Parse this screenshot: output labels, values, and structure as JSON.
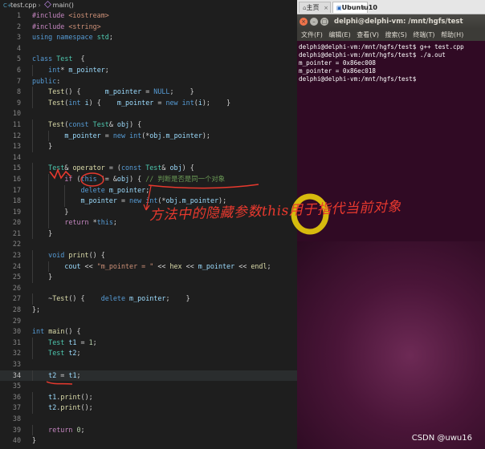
{
  "editor": {
    "breadcrumb": {
      "file": "test.cpp",
      "symbol": "main()"
    },
    "cursor_line": "34",
    "lines": [
      {
        "n": "1",
        "html": "<span class=\"pp\">#include</span> <span class=\"inc\">&lt;iostream&gt;</span>"
      },
      {
        "n": "2",
        "html": "<span class=\"pp\">#include</span> <span class=\"inc\">&lt;string&gt;</span>"
      },
      {
        "n": "3",
        "html": "<span class=\"kw\">using</span> <span class=\"kw\">namespace</span> <span class=\"ty\">std</span>;"
      },
      {
        "n": "4",
        "html": ""
      },
      {
        "n": "5",
        "html": "<span class=\"kw\">class</span> <span class=\"ty\">Test</span>  {"
      },
      {
        "n": "6",
        "html": "    <span class=\"kw\">int</span>* <span class=\"var\">m_pointer</span>;"
      },
      {
        "n": "7",
        "html": "<span class=\"kw\">public</span>:"
      },
      {
        "n": "8",
        "html": "    <span class=\"fn\">Test</span>() {      <span class=\"var\">m_pointer</span> = <span class=\"kw\">NULL</span>;    }"
      },
      {
        "n": "9",
        "html": "    <span class=\"fn\">Test</span>(<span class=\"kw\">int</span> <span class=\"var\">i</span>) {    <span class=\"var\">m_pointer</span> = <span class=\"kw\">new</span> <span class=\"kw\">int</span>(<span class=\"var\">i</span>);    }"
      },
      {
        "n": "10",
        "html": ""
      },
      {
        "n": "11",
        "html": "    <span class=\"fn\">Test</span>(<span class=\"kw\">const</span> <span class=\"ty\">Test</span>&amp; <span class=\"var\">obj</span>) {"
      },
      {
        "n": "12",
        "html": "        <span class=\"var\">m_pointer</span> = <span class=\"kw\">new</span> <span class=\"kw\">int</span>(*<span class=\"var\">obj</span>.<span class=\"var\">m_pointer</span>);"
      },
      {
        "n": "13",
        "html": "    }"
      },
      {
        "n": "14",
        "html": ""
      },
      {
        "n": "15",
        "html": "    <span class=\"ty\">Test</span>&amp; <span class=\"fn\">operator</span> = (<span class=\"kw\">const</span> <span class=\"ty\">Test</span>&amp; <span class=\"var\">obj</span>) {"
      },
      {
        "n": "16",
        "html": "        <span class=\"ctl\">if</span> (<span class=\"kw\">this</span> != &amp;<span class=\"var\">obj</span>) { <span class=\"com\">// 判断是否是同一个对象</span>"
      },
      {
        "n": "17",
        "html": "            <span class=\"kw\">delete</span> <span class=\"var\">m_pointer</span>;"
      },
      {
        "n": "18",
        "html": "            <span class=\"var\">m_pointer</span> = <span class=\"kw\">new</span> <span class=\"kw\">int</span>(*<span class=\"var\">obj</span>.<span class=\"var\">m_pointer</span>);"
      },
      {
        "n": "19",
        "html": "        }"
      },
      {
        "n": "20",
        "html": "        <span class=\"ctl\">return</span> *<span class=\"kw\">this</span>;"
      },
      {
        "n": "21",
        "html": "    }"
      },
      {
        "n": "22",
        "html": ""
      },
      {
        "n": "23",
        "html": "    <span class=\"kw\">void</span> <span class=\"fn\">print</span>() {"
      },
      {
        "n": "24",
        "html": "        <span class=\"var\">cout</span> &lt;&lt; <span class=\"str\">\"m_pointer = \"</span> &lt;&lt; <span class=\"fn\">hex</span> &lt;&lt; <span class=\"var\">m_pointer</span> &lt;&lt; <span class=\"fn\">endl</span>;"
      },
      {
        "n": "25",
        "html": "    }"
      },
      {
        "n": "26",
        "html": ""
      },
      {
        "n": "27",
        "html": "    ~<span class=\"fn\">Test</span>() {    <span class=\"kw\">delete</span> <span class=\"var\">m_pointer</span>;    }"
      },
      {
        "n": "28",
        "html": "};"
      },
      {
        "n": "29",
        "html": ""
      },
      {
        "n": "30",
        "html": "<span class=\"kw\">int</span> <span class=\"fn\">main</span>() {"
      },
      {
        "n": "31",
        "html": "    <span class=\"ty\">Test</span> <span class=\"var\">t1</span> = <span class=\"num\">1</span>;"
      },
      {
        "n": "32",
        "html": "    <span class=\"ty\">Test</span> <span class=\"var\">t2</span>;"
      },
      {
        "n": "33",
        "html": ""
      },
      {
        "n": "34",
        "html": "    <span class=\"var\">t2</span> = <span class=\"var\">t1</span>;"
      },
      {
        "n": "35",
        "html": ""
      },
      {
        "n": "36",
        "html": "    <span class=\"var\">t1</span>.<span class=\"fn\">print</span>();"
      },
      {
        "n": "37",
        "html": "    <span class=\"var\">t2</span>.<span class=\"fn\">print</span>();"
      },
      {
        "n": "38",
        "html": ""
      },
      {
        "n": "39",
        "html": "    <span class=\"ctl\">return</span> <span class=\"num\">0</span>;"
      },
      {
        "n": "40",
        "html": "}"
      }
    ]
  },
  "annotation": {
    "handwritten_note": "方法中的隐藏参数this用于指代当前对象",
    "ink_color": "#e8392e",
    "highlight_color": "#f5d90a"
  },
  "terminal": {
    "tabs": [
      "主页",
      "Ubuntu10"
    ],
    "title": "delphi@delphi-vm: /mnt/hgfs/test",
    "menu": [
      "文件(F)",
      "编辑(E)",
      "查看(V)",
      "搜索(S)",
      "终端(T)",
      "帮助(H)"
    ],
    "output": [
      "delphi@delphi-vm:/mnt/hgfs/test$ g++ test.cpp",
      "delphi@delphi-vm:/mnt/hgfs/test$ ./a.out",
      "m_pointer = 0x86ec008",
      "m_pointer = 0x86ec018",
      "delphi@delphi-vm:/mnt/hgfs/test$ "
    ],
    "bg_color": "#300a24"
  },
  "watermark": "CSDN @uwu16"
}
